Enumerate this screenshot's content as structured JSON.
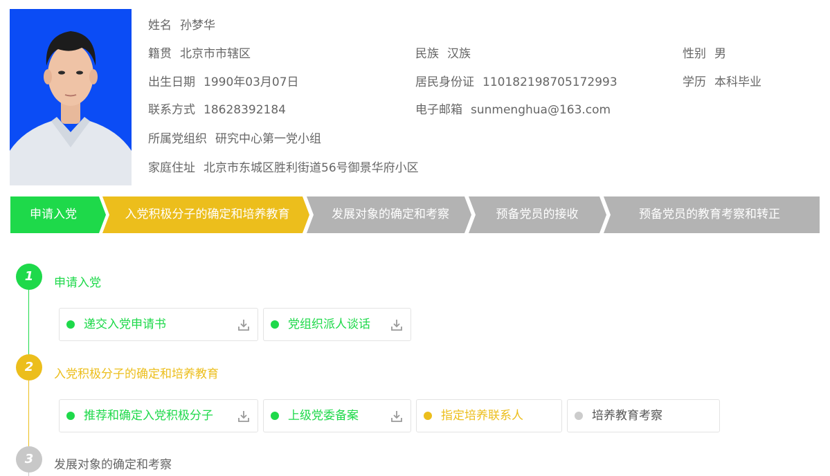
{
  "profile": {
    "name": {
      "label": "姓名",
      "value": "孙梦华"
    },
    "native_place": {
      "label": "籍贯",
      "value": "北京市市辖区"
    },
    "ethnicity": {
      "label": "民族",
      "value": "汉族"
    },
    "gender": {
      "label": "性别",
      "value": "男"
    },
    "birth_date": {
      "label": "出生日期",
      "value": "1990年03月07日"
    },
    "id_card": {
      "label": "居民身份证",
      "value": "110182198705172993"
    },
    "education": {
      "label": "学历",
      "value": "本科毕业"
    },
    "phone": {
      "label": "联系方式",
      "value": "18628392184"
    },
    "email": {
      "label": "电子邮箱",
      "value": "sunmenghua@163.com"
    },
    "party_org": {
      "label": "所属党组织",
      "value": "研究中心第一党小组"
    },
    "address": {
      "label": "家庭住址",
      "value": "北京市东城区胜利街道56号御景华府小区"
    }
  },
  "steps": [
    {
      "label": "申请入党",
      "status": "done",
      "color": "#1ed94a"
    },
    {
      "label": "入党积极分子的确定和培养教育",
      "status": "current",
      "color": "#ecbe1c"
    },
    {
      "label": "发展对象的确定和考察",
      "status": "todo",
      "color": "#b3b3b3"
    },
    {
      "label": "预备党员的接收",
      "status": "todo",
      "color": "#b3b3b3"
    },
    {
      "label": "预备党员的教育考察和转正",
      "status": "todo",
      "color": "#b3b3b3"
    }
  ],
  "timeline": [
    {
      "number": "1",
      "title": "申请入党",
      "color": "#1ed94a",
      "items": [
        {
          "label": "递交入党申请书",
          "status": "done",
          "download": true
        },
        {
          "label": "党组织派人谈话",
          "status": "done",
          "download": true
        }
      ]
    },
    {
      "number": "2",
      "title": "入党积极分子的确定和培养教育",
      "color": "#ecbe1c",
      "items": [
        {
          "label": "推荐和确定入党积极分子",
          "status": "done",
          "download": true
        },
        {
          "label": "上级党委备案",
          "status": "done",
          "download": true
        },
        {
          "label": "指定培养联系人",
          "status": "current",
          "download": false
        },
        {
          "label": "培养教育考察",
          "status": "todo",
          "download": false
        }
      ]
    },
    {
      "number": "3",
      "title": "发展对象的确定和考察",
      "color": "#c8c8c8",
      "items": []
    }
  ],
  "icons": {
    "download": "download-icon",
    "avatar": "profile-photo"
  },
  "colors": {
    "green": "#1ed94a",
    "yellow": "#ecbe1c",
    "gray": "#b3b3b3",
    "photo_bg": "#0b4cf5"
  }
}
